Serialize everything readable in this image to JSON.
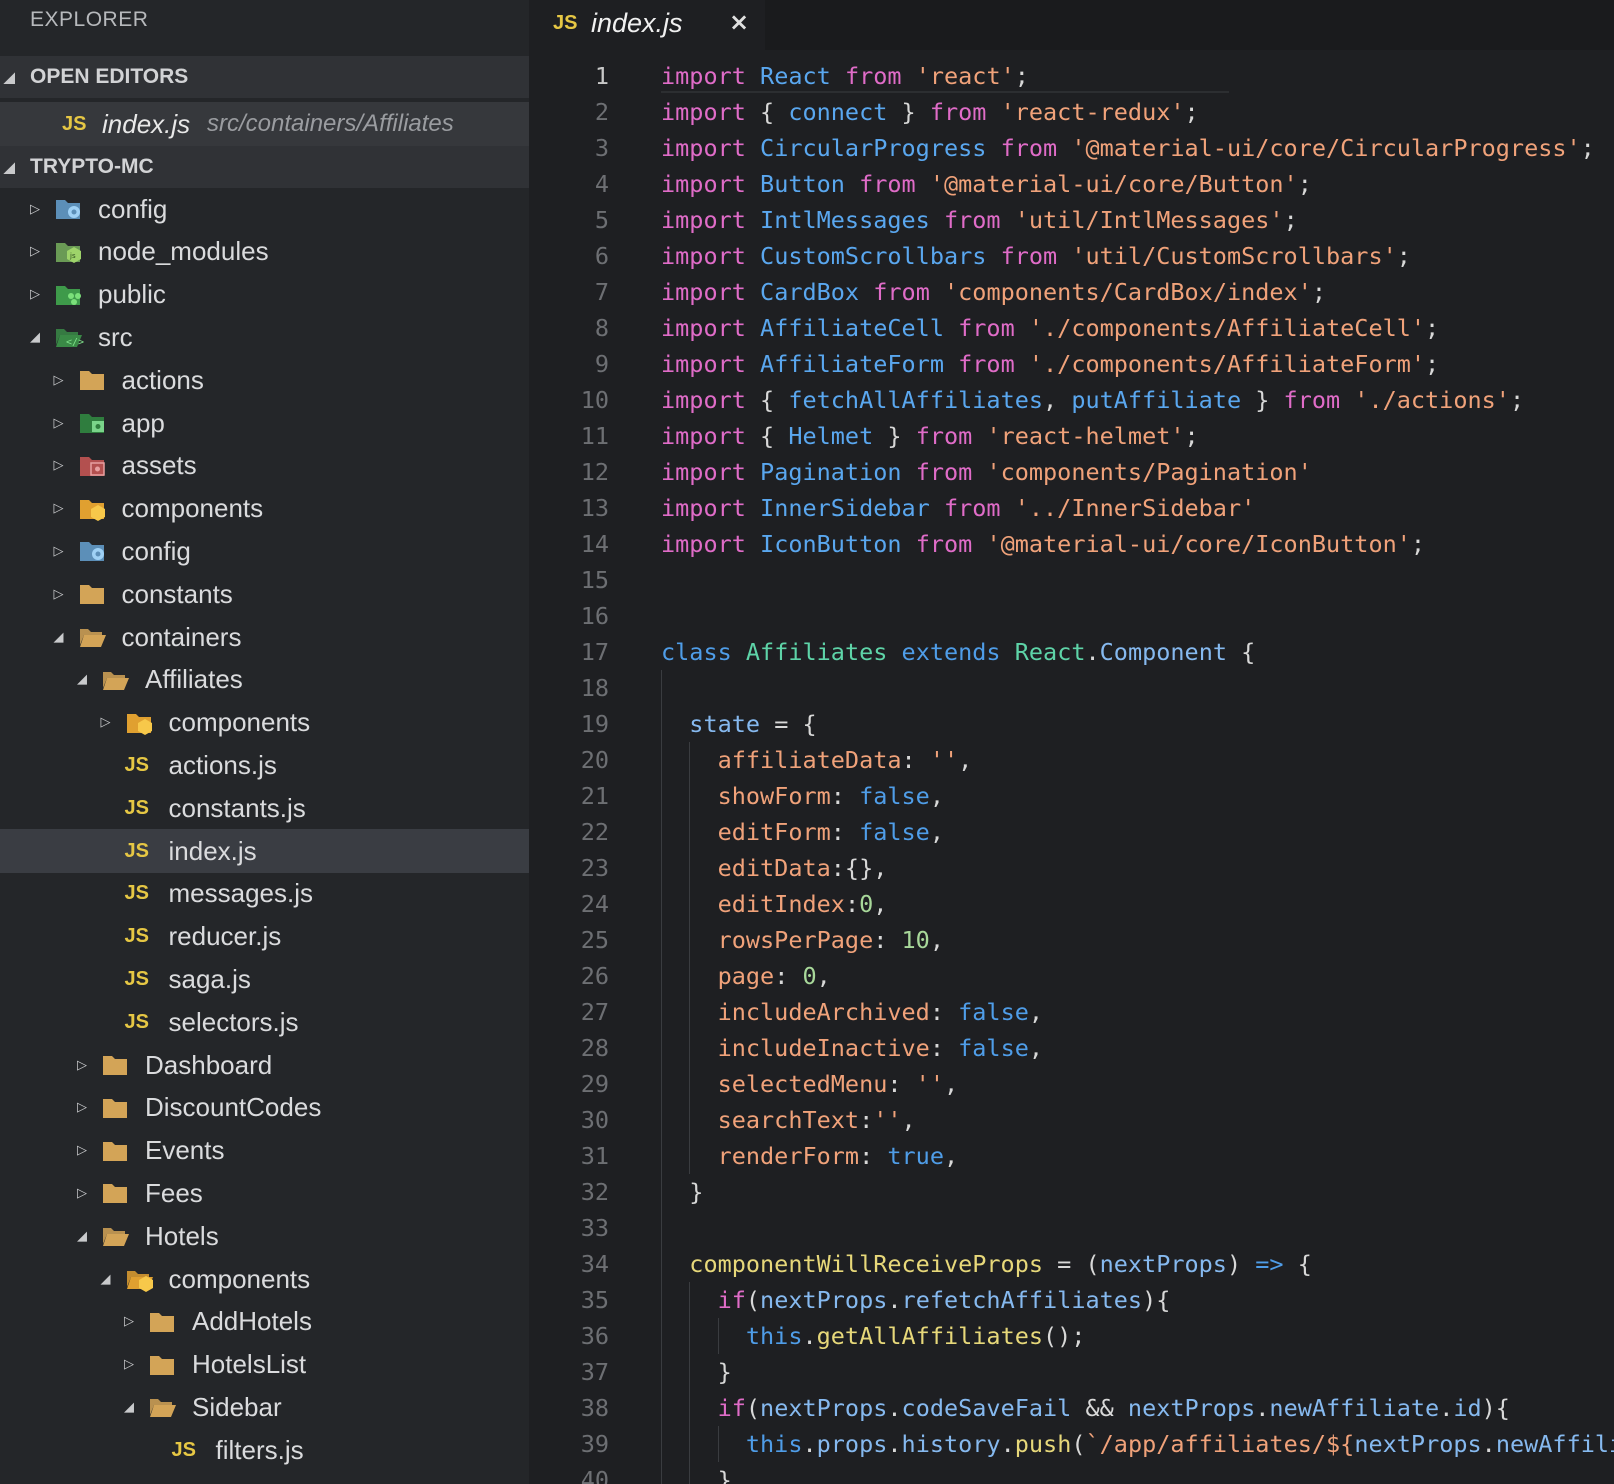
{
  "sidebar": {
    "title": "EXPLORER",
    "open_editors_label": "OPEN EDITORS",
    "open_editor": {
      "badge": "JS",
      "name": "index.js",
      "path": "src/containers/Affiliates"
    },
    "project_label": "TRYPTO-MC",
    "tree": [
      {
        "label": "config",
        "type": "folder-config",
        "depth": 0,
        "expanded": false
      },
      {
        "label": "node_modules",
        "type": "folder-node",
        "depth": 0,
        "expanded": false
      },
      {
        "label": "public",
        "type": "folder-public",
        "depth": 0,
        "expanded": false
      },
      {
        "label": "src",
        "type": "folder-src",
        "depth": 0,
        "expanded": true
      },
      {
        "label": "actions",
        "type": "folder",
        "depth": 1,
        "expanded": false
      },
      {
        "label": "app",
        "type": "folder-app",
        "depth": 1,
        "expanded": false
      },
      {
        "label": "assets",
        "type": "folder-assets",
        "depth": 1,
        "expanded": false
      },
      {
        "label": "components",
        "type": "folder-components",
        "depth": 1,
        "expanded": false
      },
      {
        "label": "config",
        "type": "folder-config",
        "depth": 1,
        "expanded": false
      },
      {
        "label": "constants",
        "type": "folder",
        "depth": 1,
        "expanded": false
      },
      {
        "label": "containers",
        "type": "folder-open",
        "depth": 1,
        "expanded": true
      },
      {
        "label": "Affiliates",
        "type": "folder-open",
        "depth": 2,
        "expanded": true
      },
      {
        "label": "components",
        "type": "folder-components",
        "depth": 3,
        "expanded": false
      },
      {
        "label": "actions.js",
        "type": "js",
        "depth": 3
      },
      {
        "label": "constants.js",
        "type": "js",
        "depth": 3
      },
      {
        "label": "index.js",
        "type": "js",
        "depth": 3,
        "selected": true
      },
      {
        "label": "messages.js",
        "type": "js",
        "depth": 3
      },
      {
        "label": "reducer.js",
        "type": "js",
        "depth": 3
      },
      {
        "label": "saga.js",
        "type": "js",
        "depth": 3
      },
      {
        "label": "selectors.js",
        "type": "js",
        "depth": 3
      },
      {
        "label": "Dashboard",
        "type": "folder",
        "depth": 2,
        "expanded": false
      },
      {
        "label": "DiscountCodes",
        "type": "folder",
        "depth": 2,
        "expanded": false
      },
      {
        "label": "Events",
        "type": "folder",
        "depth": 2,
        "expanded": false
      },
      {
        "label": "Fees",
        "type": "folder",
        "depth": 2,
        "expanded": false
      },
      {
        "label": "Hotels",
        "type": "folder-open",
        "depth": 2,
        "expanded": true
      },
      {
        "label": "components",
        "type": "folder-components-open",
        "depth": 3,
        "expanded": true
      },
      {
        "label": "AddHotels",
        "type": "folder",
        "depth": 4,
        "expanded": false
      },
      {
        "label": "HotelsList",
        "type": "folder",
        "depth": 4,
        "expanded": false
      },
      {
        "label": "Sidebar",
        "type": "folder-open",
        "depth": 4,
        "expanded": true
      },
      {
        "label": "filters.js",
        "type": "js",
        "depth": 5
      }
    ]
  },
  "editor": {
    "tab": {
      "badge": "JS",
      "name": "index.js",
      "close": "×"
    },
    "current_line": 1,
    "lines": [
      [
        [
          "k",
          "import"
        ],
        [
          "p",
          " "
        ],
        [
          "b",
          "React"
        ],
        [
          "p",
          " "
        ],
        [
          "k",
          "from"
        ],
        [
          "p",
          " "
        ],
        [
          "s",
          "'react'"
        ],
        [
          "p",
          ";"
        ]
      ],
      [
        [
          "k",
          "import"
        ],
        [
          "p",
          " { "
        ],
        [
          "b",
          "connect"
        ],
        [
          "p",
          " } "
        ],
        [
          "k",
          "from"
        ],
        [
          "p",
          " "
        ],
        [
          "s",
          "'react-redux'"
        ],
        [
          "p",
          ";"
        ]
      ],
      [
        [
          "k",
          "import"
        ],
        [
          "p",
          " "
        ],
        [
          "b",
          "CircularProgress"
        ],
        [
          "p",
          " "
        ],
        [
          "k",
          "from"
        ],
        [
          "p",
          " "
        ],
        [
          "s",
          "'@material-ui/core/CircularProgress'"
        ],
        [
          "p",
          ";"
        ]
      ],
      [
        [
          "k",
          "import"
        ],
        [
          "p",
          " "
        ],
        [
          "b",
          "Button"
        ],
        [
          "p",
          " "
        ],
        [
          "k",
          "from"
        ],
        [
          "p",
          " "
        ],
        [
          "s",
          "'@material-ui/core/Button'"
        ],
        [
          "p",
          ";"
        ]
      ],
      [
        [
          "k",
          "import"
        ],
        [
          "p",
          " "
        ],
        [
          "b",
          "IntlMessages"
        ],
        [
          "p",
          " "
        ],
        [
          "k",
          "from"
        ],
        [
          "p",
          " "
        ],
        [
          "s",
          "'util/IntlMessages'"
        ],
        [
          "p",
          ";"
        ]
      ],
      [
        [
          "k",
          "import"
        ],
        [
          "p",
          " "
        ],
        [
          "b",
          "CustomScrollbars"
        ],
        [
          "p",
          " "
        ],
        [
          "k",
          "from"
        ],
        [
          "p",
          " "
        ],
        [
          "s",
          "'util/CustomScrollbars'"
        ],
        [
          "p",
          ";"
        ]
      ],
      [
        [
          "k",
          "import"
        ],
        [
          "p",
          " "
        ],
        [
          "b",
          "CardBox"
        ],
        [
          "p",
          " "
        ],
        [
          "k",
          "from"
        ],
        [
          "p",
          " "
        ],
        [
          "s",
          "'components/CardBox/index'"
        ],
        [
          "p",
          ";"
        ]
      ],
      [
        [
          "k",
          "import"
        ],
        [
          "p",
          " "
        ],
        [
          "b",
          "AffiliateCell"
        ],
        [
          "p",
          " "
        ],
        [
          "k",
          "from"
        ],
        [
          "p",
          " "
        ],
        [
          "s",
          "'./components/AffiliateCell'"
        ],
        [
          "p",
          ";"
        ]
      ],
      [
        [
          "k",
          "import"
        ],
        [
          "p",
          " "
        ],
        [
          "b",
          "AffiliateForm"
        ],
        [
          "p",
          " "
        ],
        [
          "k",
          "from"
        ],
        [
          "p",
          " "
        ],
        [
          "s",
          "'./components/AffiliateForm'"
        ],
        [
          "p",
          ";"
        ]
      ],
      [
        [
          "k",
          "import"
        ],
        [
          "p",
          " { "
        ],
        [
          "b",
          "fetchAllAffiliates"
        ],
        [
          "p",
          ", "
        ],
        [
          "b",
          "putAffiliate"
        ],
        [
          "p",
          " } "
        ],
        [
          "k",
          "from"
        ],
        [
          "p",
          " "
        ],
        [
          "s",
          "'./actions'"
        ],
        [
          "p",
          ";"
        ]
      ],
      [
        [
          "k",
          "import"
        ],
        [
          "p",
          " { "
        ],
        [
          "b",
          "Helmet"
        ],
        [
          "p",
          " } "
        ],
        [
          "k",
          "from"
        ],
        [
          "p",
          " "
        ],
        [
          "s",
          "'react-helmet'"
        ],
        [
          "p",
          ";"
        ]
      ],
      [
        [
          "k",
          "import"
        ],
        [
          "p",
          " "
        ],
        [
          "b",
          "Pagination"
        ],
        [
          "p",
          " "
        ],
        [
          "k",
          "from"
        ],
        [
          "p",
          " "
        ],
        [
          "s",
          "'components/Pagination'"
        ]
      ],
      [
        [
          "k",
          "import"
        ],
        [
          "p",
          " "
        ],
        [
          "b",
          "InnerSidebar"
        ],
        [
          "p",
          " "
        ],
        [
          "k",
          "from"
        ],
        [
          "p",
          " "
        ],
        [
          "s",
          "'../InnerSidebar'"
        ]
      ],
      [
        [
          "k",
          "import"
        ],
        [
          "p",
          " "
        ],
        [
          "b",
          "IconButton"
        ],
        [
          "p",
          " "
        ],
        [
          "k",
          "from"
        ],
        [
          "p",
          " "
        ],
        [
          "s",
          "'@material-ui/core/IconButton'"
        ],
        [
          "p",
          ";"
        ]
      ],
      [],
      [],
      [
        [
          "bo",
          "class"
        ],
        [
          "p",
          " "
        ],
        [
          "c",
          "Affiliates"
        ],
        [
          "p",
          " "
        ],
        [
          "bo",
          "extends"
        ],
        [
          "p",
          " "
        ],
        [
          "c",
          "React"
        ],
        [
          "p",
          "."
        ],
        [
          "ob",
          "Component"
        ],
        [
          "p",
          " {"
        ]
      ],
      [],
      [
        [
          "p",
          "  "
        ],
        [
          "ob",
          "state"
        ],
        [
          "p",
          " = {"
        ]
      ],
      [
        [
          "p",
          "    "
        ],
        [
          "n",
          "affiliateData"
        ],
        [
          "p",
          ": "
        ],
        [
          "s",
          "''"
        ],
        [
          "p",
          ","
        ]
      ],
      [
        [
          "p",
          "    "
        ],
        [
          "n",
          "showForm"
        ],
        [
          "p",
          ": "
        ],
        [
          "bo",
          "false"
        ],
        [
          "p",
          ","
        ]
      ],
      [
        [
          "p",
          "    "
        ],
        [
          "n",
          "editForm"
        ],
        [
          "p",
          ": "
        ],
        [
          "bo",
          "false"
        ],
        [
          "p",
          ","
        ]
      ],
      [
        [
          "p",
          "    "
        ],
        [
          "n",
          "editData"
        ],
        [
          "p",
          ":{},"
        ]
      ],
      [
        [
          "p",
          "    "
        ],
        [
          "n",
          "editIndex"
        ],
        [
          "p",
          ":"
        ],
        [
          "nu",
          "0"
        ],
        [
          "p",
          ","
        ]
      ],
      [
        [
          "p",
          "    "
        ],
        [
          "n",
          "rowsPerPage"
        ],
        [
          "p",
          ": "
        ],
        [
          "nu",
          "10"
        ],
        [
          "p",
          ","
        ]
      ],
      [
        [
          "p",
          "    "
        ],
        [
          "n",
          "page"
        ],
        [
          "p",
          ": "
        ],
        [
          "nu",
          "0"
        ],
        [
          "p",
          ","
        ]
      ],
      [
        [
          "p",
          "    "
        ],
        [
          "n",
          "includeArchived"
        ],
        [
          "p",
          ": "
        ],
        [
          "bo",
          "false"
        ],
        [
          "p",
          ","
        ]
      ],
      [
        [
          "p",
          "    "
        ],
        [
          "n",
          "includeInactive"
        ],
        [
          "p",
          ": "
        ],
        [
          "bo",
          "false"
        ],
        [
          "p",
          ","
        ]
      ],
      [
        [
          "p",
          "    "
        ],
        [
          "n",
          "selectedMenu"
        ],
        [
          "p",
          ": "
        ],
        [
          "s",
          "''"
        ],
        [
          "p",
          ","
        ]
      ],
      [
        [
          "p",
          "    "
        ],
        [
          "n",
          "searchText"
        ],
        [
          "p",
          ":"
        ],
        [
          "s",
          "''"
        ],
        [
          "p",
          ","
        ]
      ],
      [
        [
          "p",
          "    "
        ],
        [
          "n",
          "renderForm"
        ],
        [
          "p",
          ": "
        ],
        [
          "bo",
          "true"
        ],
        [
          "p",
          ","
        ]
      ],
      [
        [
          "p",
          "  }"
        ]
      ],
      [],
      [
        [
          "p",
          "  "
        ],
        [
          "fn",
          "componentWillReceiveProps"
        ],
        [
          "p",
          " = ("
        ],
        [
          "ob",
          "nextProps"
        ],
        [
          "p",
          ") "
        ],
        [
          "bo",
          "=>"
        ],
        [
          "p",
          " {"
        ]
      ],
      [
        [
          "p",
          "    "
        ],
        [
          "k",
          "if"
        ],
        [
          "p",
          "("
        ],
        [
          "ob",
          "nextProps"
        ],
        [
          "p",
          "."
        ],
        [
          "ob",
          "refetchAffiliates"
        ],
        [
          "p",
          "){"
        ]
      ],
      [
        [
          "p",
          "      "
        ],
        [
          "th",
          "this"
        ],
        [
          "p",
          "."
        ],
        [
          "fn",
          "getAllAffiliates"
        ],
        [
          "p",
          "();"
        ]
      ],
      [
        [
          "p",
          "    }"
        ]
      ],
      [
        [
          "p",
          "    "
        ],
        [
          "k",
          "if"
        ],
        [
          "p",
          "("
        ],
        [
          "ob",
          "nextProps"
        ],
        [
          "p",
          "."
        ],
        [
          "ob",
          "codeSaveFail"
        ],
        [
          "p",
          " && "
        ],
        [
          "ob",
          "nextProps"
        ],
        [
          "p",
          "."
        ],
        [
          "ob",
          "newAffiliate"
        ],
        [
          "p",
          "."
        ],
        [
          "ob",
          "id"
        ],
        [
          "p",
          "){"
        ]
      ],
      [
        [
          "p",
          "      "
        ],
        [
          "th",
          "this"
        ],
        [
          "p",
          "."
        ],
        [
          "ob",
          "props"
        ],
        [
          "p",
          "."
        ],
        [
          "ob",
          "history"
        ],
        [
          "p",
          "."
        ],
        [
          "fn",
          "push"
        ],
        [
          "p",
          "("
        ],
        [
          "s",
          "`/app/affiliates/${"
        ],
        [
          "ob",
          "nextProps"
        ],
        [
          "p",
          "."
        ],
        [
          "ob",
          "newAffiliate"
        ],
        [
          "s",
          "}`"
        ],
        [
          "p",
          ");"
        ]
      ],
      [
        [
          "p",
          "    }"
        ]
      ]
    ]
  },
  "colors": {
    "sidebar_bg": "#242629",
    "editor_bg": "#1e1f22",
    "keyword": "#e06cc8",
    "string": "#f0a27a",
    "identifier": "#5aa7ef",
    "js_badge": "#e6c744",
    "folder": "#d3a457"
  }
}
